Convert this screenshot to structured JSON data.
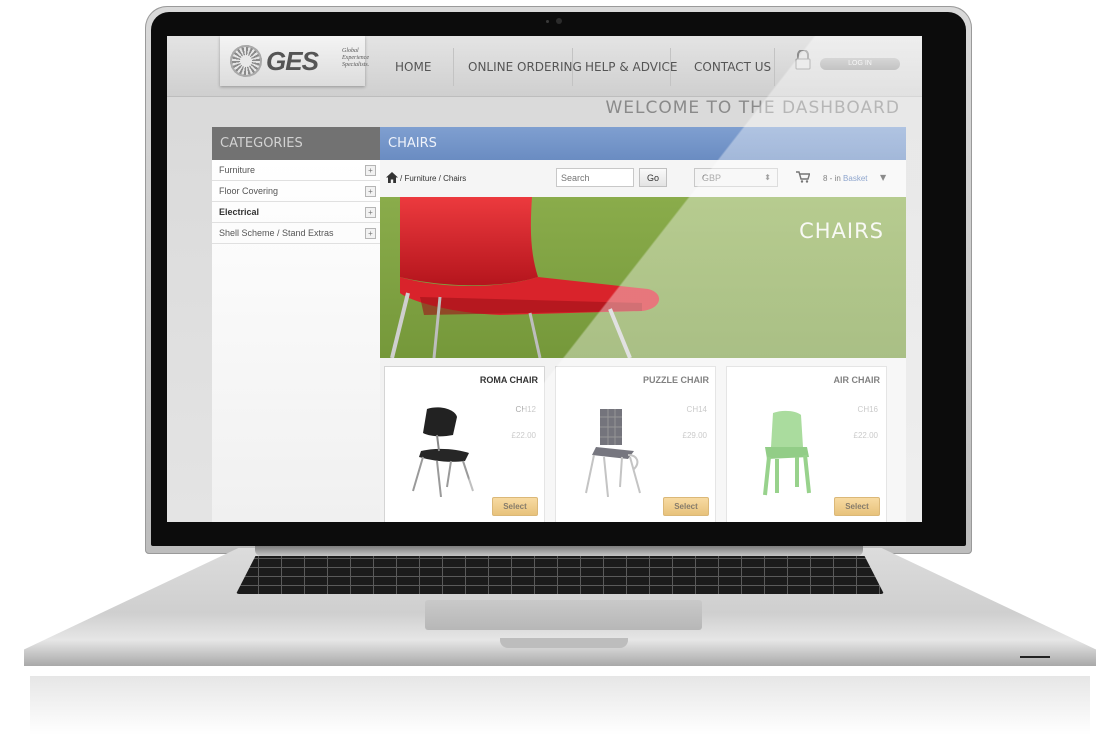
{
  "nav": {
    "logo": {
      "name": "GES",
      "tagline": [
        "Global",
        "Experience",
        "Specialists."
      ]
    },
    "items": [
      "HOME",
      "ONLINE ORDERING",
      "HELP & ADVICE",
      "CONTACT US"
    ],
    "login": "LOG IN"
  },
  "welcome": "WELCOME TO THE DASHBOARD",
  "sidebar": {
    "title": "CATEGORIES",
    "items": [
      {
        "label": "Furniture"
      },
      {
        "label": "Floor Covering"
      },
      {
        "label": "Electrical"
      },
      {
        "label": "Shell Scheme / Stand Extras"
      }
    ],
    "expand_glyph": "+"
  },
  "main": {
    "title": "CHAIRS",
    "breadcrumb": "/ Furniture / Chairs",
    "search_placeholder": "Search",
    "go_label": "Go",
    "currency": "GBP",
    "basket_count": "8 - in",
    "basket_link": "Basket",
    "banner_title": "CHAIRS"
  },
  "products": [
    {
      "name": "ROMA CHAIR",
      "code": "CH12",
      "price": "£22.00",
      "button": "Select",
      "color": "#2a2a2a"
    },
    {
      "name": "PUZZLE CHAIR",
      "code": "CH14",
      "price": "£29.00",
      "button": "Select",
      "color": "#1c1c2a"
    },
    {
      "name": "AIR CHAIR",
      "code": "CH16",
      "price": "£22.00",
      "button": "Select",
      "color": "#5fbf4a"
    }
  ],
  "colors": {
    "header_blue": "#6f90c5",
    "sidebar_gray": "#727272",
    "banner_green": "#80a244",
    "chair_red": "#d8222a",
    "select_orange": "#e8b24a"
  }
}
